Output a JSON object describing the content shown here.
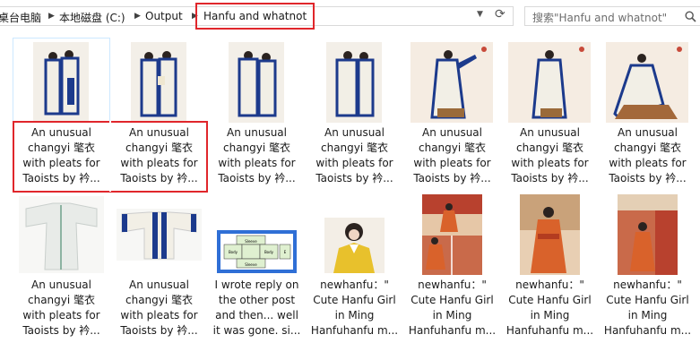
{
  "address_bar": {
    "crumbs": [
      "桌台电脑",
      "本地磁盘 (C:)",
      "Output",
      "Hanfu and whatnot"
    ],
    "dropdown_icon": "chevron-down-icon",
    "refresh_icon": "refresh-icon"
  },
  "search": {
    "placeholder": "搜索\"Hanfu and whatnot\"",
    "icon": "search-icon"
  },
  "files": [
    {
      "lines": [
        "An unusual",
        "changyi 氅衣",
        "with pleats for",
        "Taoists by 衿..."
      ]
    },
    {
      "lines": [
        "An unusual",
        "changyi 氅衣",
        "with pleats for",
        "Taoists by 衿..."
      ]
    },
    {
      "lines": [
        "An unusual",
        "changyi 氅衣",
        "with pleats for",
        "Taoists by 衿..."
      ]
    },
    {
      "lines": [
        "An unusual",
        "changyi 氅衣",
        "with pleats for",
        "Taoists by 衿..."
      ]
    },
    {
      "lines": [
        "An unusual",
        "changyi 氅衣",
        "with pleats for",
        "Taoists by 衿..."
      ]
    },
    {
      "lines": [
        "An unusual",
        "changyi 氅衣",
        "with pleats for",
        "Taoists by 衿..."
      ]
    },
    {
      "lines": [
        "An unusual",
        "changyi 氅衣",
        "with pleats for",
        "Taoists by 衿..."
      ]
    },
    {
      "lines": [
        "An unusual",
        "changyi 氅衣",
        "with pleats for",
        "Taoists by 衿..."
      ]
    },
    {
      "lines": [
        "An unusual",
        "changyi 氅衣",
        "with pleats for",
        "Taoists by 衿..."
      ]
    },
    {
      "lines": [
        "I wrote reply on",
        "the other post",
        "and then... well",
        "it was gone. si..."
      ],
      "diagram_labels": [
        "Sleeve",
        "Body",
        "Body",
        "Sleeve",
        "E"
      ]
    },
    {
      "lines": [
        "newhanfu：\"",
        "Cute Hanfu Girl",
        "in Ming",
        "Hanfuhanfu m..."
      ]
    },
    {
      "lines": [
        "newhanfu：\"",
        "Cute Hanfu Girl",
        "in Ming",
        "Hanfuhanfu m..."
      ]
    },
    {
      "lines": [
        "newhanfu：\"",
        "Cute Hanfu Girl",
        "in Ming",
        "Hanfuhanfu m..."
      ]
    },
    {
      "lines": [
        "newhanfu：\"",
        "Cute Hanfu Girl",
        "in Ming",
        "Hanfuhanfu m..."
      ]
    }
  ],
  "colors": {
    "selection_outline": "#e0262b",
    "hanfu_blue": "#1c3a8c",
    "hanfu_white": "#f2efe6",
    "ming_orange": "#d9622b",
    "palace_red": "#b8412e"
  }
}
